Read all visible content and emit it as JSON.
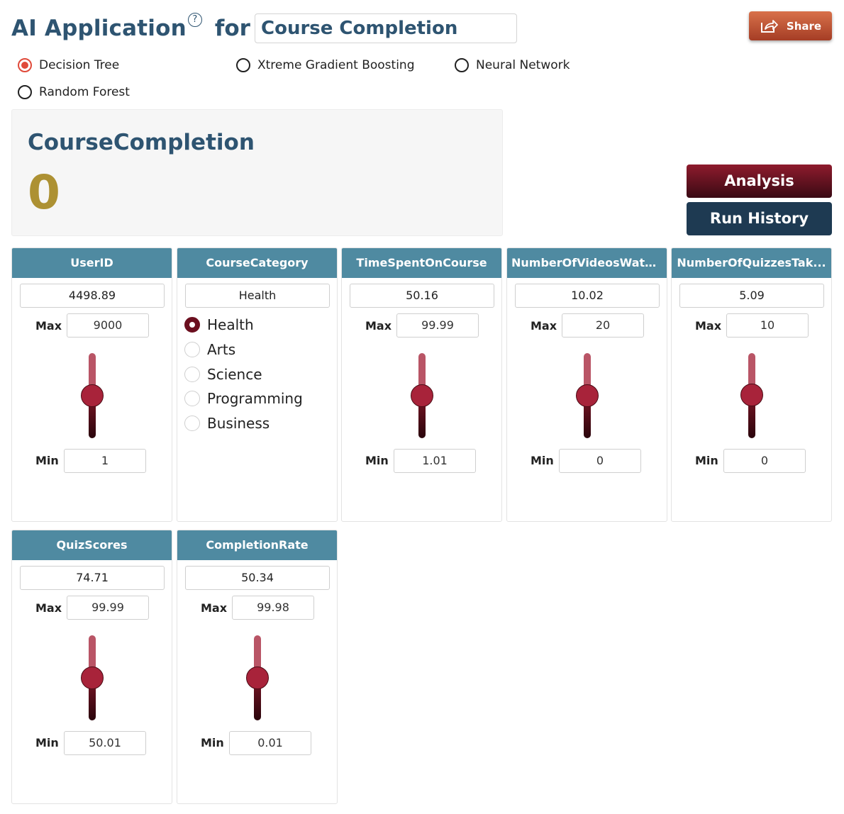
{
  "header": {
    "app_title": "AI Application",
    "help_glyph": "?",
    "for_text": "for",
    "target_value": "Course Completion",
    "share_label": "Share"
  },
  "models": [
    {
      "label": "Decision Tree",
      "selected": true
    },
    {
      "label": "Xtreme Gradient Boosting",
      "selected": false
    },
    {
      "label": "Neural Network",
      "selected": false
    },
    {
      "label": "Random Forest",
      "selected": false
    }
  ],
  "result": {
    "label": "CourseCompletion",
    "value": "0"
  },
  "actions": {
    "analysis_label": "Analysis",
    "history_label": "Run History"
  },
  "labels": {
    "max": "Max",
    "min": "Min"
  },
  "features": [
    {
      "name": "UserID",
      "value": "4498.89",
      "max": "9000",
      "min": "1",
      "level": 0.5
    },
    {
      "name": "CourseCategory",
      "value": "Health",
      "options": [
        "Health",
        "Arts",
        "Science",
        "Programming",
        "Business"
      ],
      "selected": "Health"
    },
    {
      "name": "TimeSpentOnCourse",
      "value": "50.16",
      "max": "99.99",
      "min": "1.01",
      "level": 0.5
    },
    {
      "name": "NumberOfVideosWatc...",
      "value": "10.02",
      "max": "20",
      "min": "0",
      "level": 0.5
    },
    {
      "name": "NumberOfQuizzesTak...",
      "value": "5.09",
      "max": "10",
      "min": "0",
      "level": 0.51
    },
    {
      "name": "QuizScores",
      "value": "74.71",
      "max": "99.99",
      "min": "50.01",
      "level": 0.5
    },
    {
      "name": "CompletionRate",
      "value": "50.34",
      "max": "99.98",
      "min": "0.01",
      "level": 0.5
    }
  ],
  "colors": {
    "title": "#2e5471",
    "card_header": "#4f8aa1",
    "result_value": "#ad9133",
    "accent_red": "#e04a3a",
    "slider_thumb": "#a8233a"
  },
  "icons": [
    "help-icon",
    "share-icon"
  ]
}
